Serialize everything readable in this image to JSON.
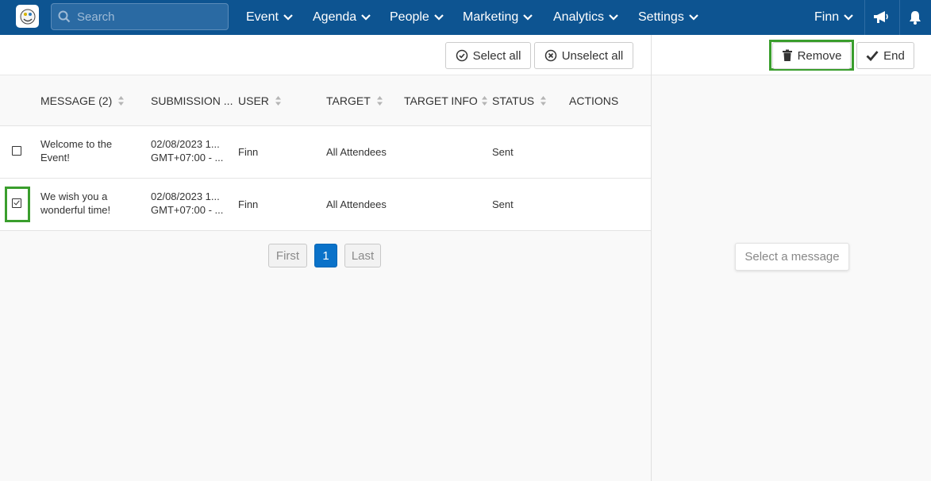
{
  "colors": {
    "nav_bg": "#0d5491",
    "accent": "#0a72c9",
    "highlight": "#3a9e2d"
  },
  "nav": {
    "search_placeholder": "Search",
    "menu": [
      {
        "label": "Event"
      },
      {
        "label": "Agenda"
      },
      {
        "label": "People"
      },
      {
        "label": "Marketing"
      },
      {
        "label": "Analytics"
      },
      {
        "label": "Settings"
      }
    ],
    "user": "Finn",
    "icons": [
      "megaphone-icon",
      "bell-icon"
    ]
  },
  "toolbar": {
    "select_all": "Select all",
    "unselect_all": "Unselect all",
    "remove": "Remove",
    "end": "End"
  },
  "table": {
    "columns": [
      "MESSAGE (2)",
      "SUBMISSION ...",
      "USER",
      "TARGET",
      "TARGET INFO",
      "STATUS",
      "ACTIONS"
    ],
    "rows": [
      {
        "checked": false,
        "message_1": "Welcome to the",
        "message_2": "Event!",
        "submission_1": "02/08/2023 1...",
        "submission_2": "GMT+07:00 - ...",
        "user": "Finn",
        "target": "All Attendees",
        "target_info": "",
        "status": "Sent"
      },
      {
        "checked": true,
        "message_1": "We wish you a",
        "message_2": "wonderful time!",
        "submission_1": "02/08/2023 1...",
        "submission_2": "GMT+07:00 - ...",
        "user": "Finn",
        "target": "All Attendees",
        "target_info": "",
        "status": "Sent"
      }
    ]
  },
  "pagination": {
    "first": "First",
    "current": "1",
    "last": "Last"
  },
  "detail": {
    "placeholder": "Select a message"
  }
}
